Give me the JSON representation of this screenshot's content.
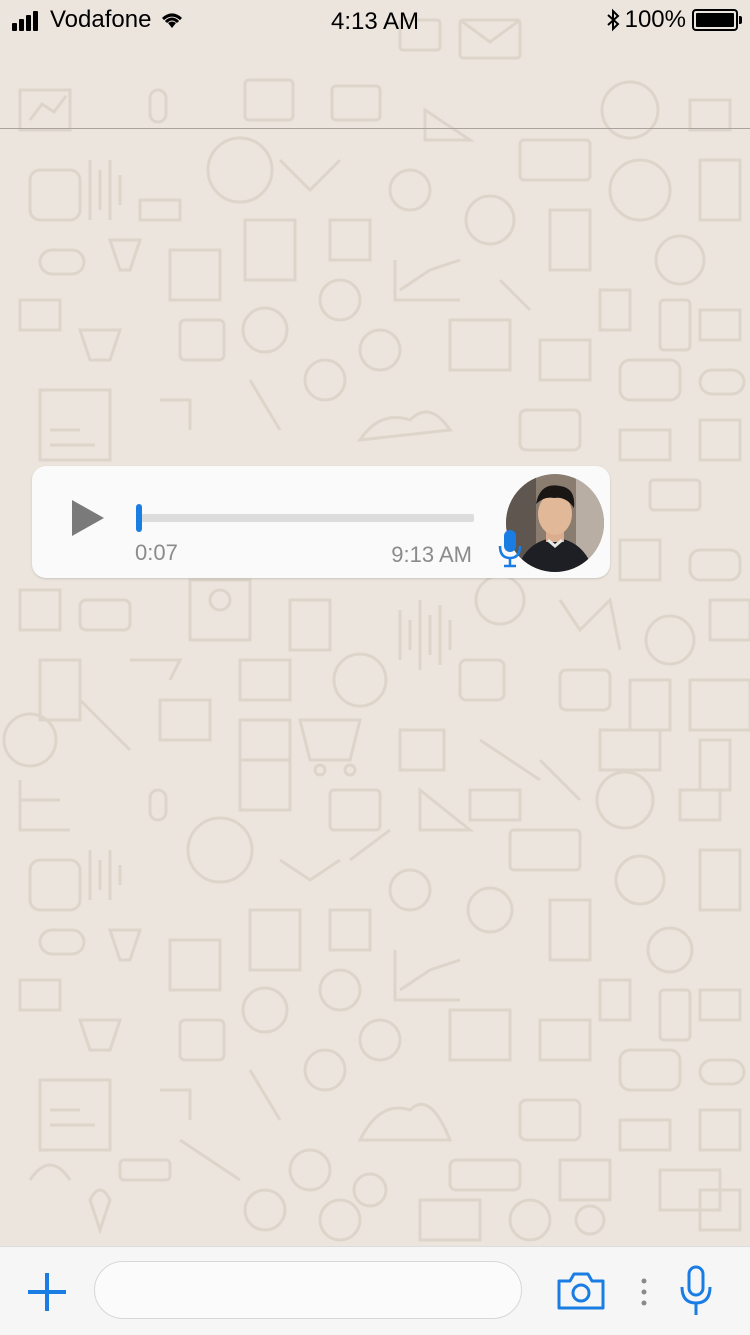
{
  "status_bar": {
    "carrier": "Vodafone",
    "time": "4:13 AM",
    "battery_percent": "100%",
    "battery_level": 1.0,
    "signal_bars": 4
  },
  "chat": {
    "voice_message": {
      "duration": "0:07",
      "timestamp": "9:13 AM",
      "progress": 0.0,
      "played": false
    }
  },
  "composer": {
    "input_value": "",
    "input_placeholder": ""
  },
  "colors": {
    "accent": "#1a7de3",
    "wallpaper": "#ece5dd",
    "wallpaper_icons": "#d9d1c6",
    "bubble": "#fafafa",
    "meta_text": "#8b8b8b"
  },
  "icons": {
    "status": [
      "signal-icon",
      "wifi-icon",
      "bluetooth-icon",
      "battery-icon"
    ],
    "bubble": [
      "play-icon",
      "mic-icon"
    ],
    "composer": [
      "plus-icon",
      "camera-icon",
      "more-dots-icon",
      "mic-icon"
    ]
  }
}
